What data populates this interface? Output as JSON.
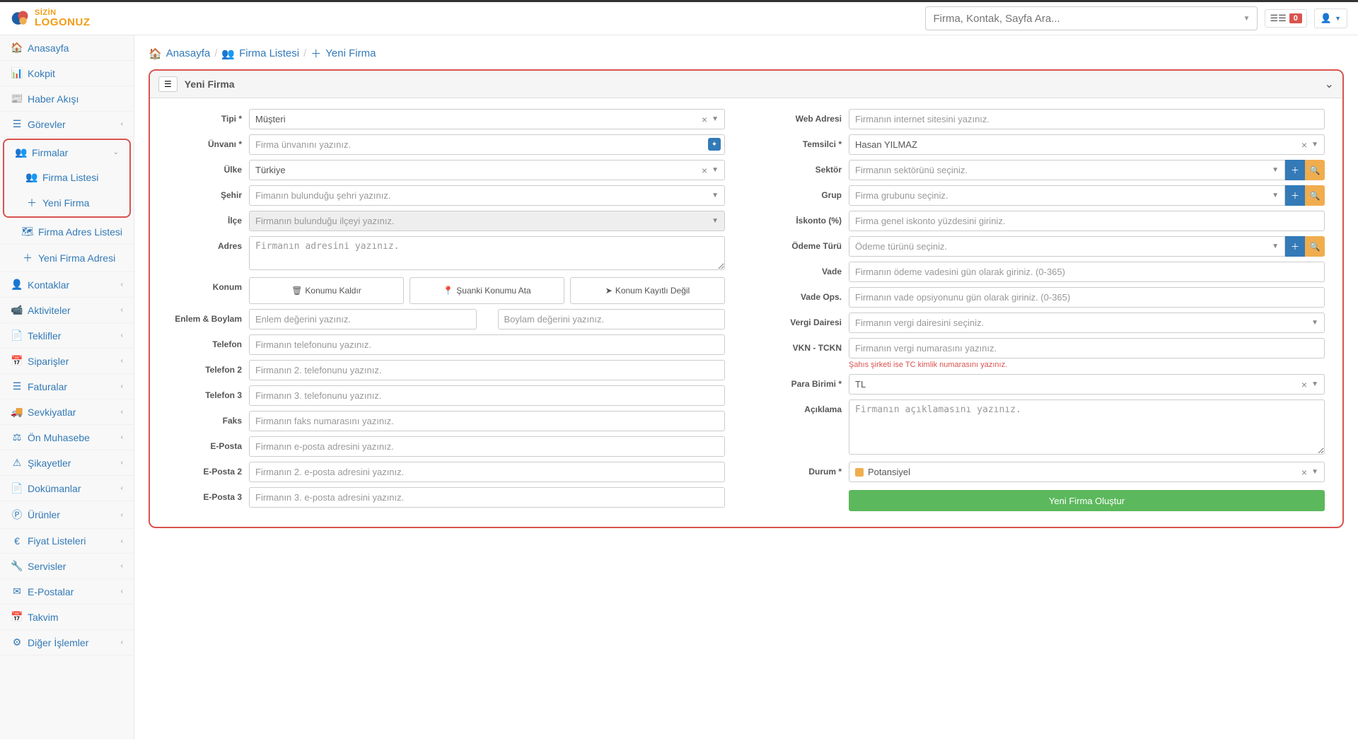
{
  "header": {
    "logo_line1": "SİZİN",
    "logo_line2": "LOGONUZ",
    "search_placeholder": "Firma, Kontak, Sayfa Ara...",
    "notification_count": "0"
  },
  "sidebar": {
    "items": [
      {
        "label": "Anasayfa",
        "icon": "home"
      },
      {
        "label": "Kokpit",
        "icon": "dashboard"
      },
      {
        "label": "Haber Akışı",
        "icon": "news"
      },
      {
        "label": "Görevler",
        "icon": "tasks",
        "chev": "‹"
      }
    ],
    "highlighted": {
      "parent": {
        "label": "Firmalar",
        "icon": "users",
        "chev": "⌄"
      },
      "children": [
        {
          "label": "Firma Listesi",
          "icon": "users"
        },
        {
          "label": "Yeni Firma",
          "icon": "plus"
        }
      ]
    },
    "items2": [
      {
        "label": "Firma Adres Listesi",
        "icon": "map"
      },
      {
        "label": "Yeni Firma Adresi",
        "icon": "plus"
      },
      {
        "label": "Kontaklar",
        "icon": "user",
        "chev": "‹"
      },
      {
        "label": "Aktiviteler",
        "icon": "video",
        "chev": "‹"
      },
      {
        "label": "Teklifler",
        "icon": "file",
        "chev": "‹"
      },
      {
        "label": "Siparişler",
        "icon": "calendar",
        "chev": "‹"
      },
      {
        "label": "Faturalar",
        "icon": "list",
        "chev": "‹"
      },
      {
        "label": "Sevkiyatlar",
        "icon": "truck",
        "chev": "‹"
      },
      {
        "label": "Ön Muhasebe",
        "icon": "balance",
        "chev": "‹"
      },
      {
        "label": "Şikayetler",
        "icon": "warning",
        "chev": "‹"
      },
      {
        "label": "Dokümanlar",
        "icon": "doc",
        "chev": "‹"
      },
      {
        "label": "Ürünler",
        "icon": "product",
        "chev": "‹"
      },
      {
        "label": "Fiyat Listeleri",
        "icon": "euro",
        "chev": "‹"
      },
      {
        "label": "Servisler",
        "icon": "wrench",
        "chev": "‹"
      },
      {
        "label": "E-Postalar",
        "icon": "mail",
        "chev": "‹"
      },
      {
        "label": "Takvim",
        "icon": "calendar2"
      },
      {
        "label": "Diğer İşlemler",
        "icon": "gear",
        "chev": "‹"
      }
    ]
  },
  "breadcrumb": {
    "home": "Anasayfa",
    "list": "Firma Listesi",
    "current": "Yeni Firma"
  },
  "panel": {
    "title": "Yeni Firma"
  },
  "form": {
    "left": {
      "tipi_label": "Tipi *",
      "tipi_value": "Müşteri",
      "unvan_label": "Ünvanı *",
      "unvan_placeholder": "Firma ünvanını yazınız.",
      "ulke_label": "Ülke",
      "ulke_value": "Türkiye",
      "sehir_label": "Şehir",
      "sehir_placeholder": "Fimanın bulunduğu şehri yazınız.",
      "ilce_label": "İlçe",
      "ilce_placeholder": "Firmanın bulunduğu ilçeyi yazınız.",
      "adres_label": "Adres",
      "adres_placeholder": "Firmanın adresini yazınız.",
      "konum_label": "Konum",
      "konum_kaldir": "Konumu Kaldır",
      "konum_ata": "Şuanki Konumu Ata",
      "konum_kayit": "Konum Kayıtlı Değil",
      "enlem_label": "Enlem & Boylam",
      "enlem_placeholder": "Enlem değerini yazınız.",
      "boylam_placeholder": "Boylam değerini yazınız.",
      "telefon_label": "Telefon",
      "telefon_placeholder": "Firmanın telefonunu yazınız.",
      "telefon2_label": "Telefon 2",
      "telefon2_placeholder": "Firmanın 2. telefonunu yazınız.",
      "telefon3_label": "Telefon 3",
      "telefon3_placeholder": "Firmanın 3. telefonunu yazınız.",
      "faks_label": "Faks",
      "faks_placeholder": "Firmanın faks numarasını yazınız.",
      "eposta_label": "E-Posta",
      "eposta_placeholder": "Firmanın e-posta adresini yazınız.",
      "eposta2_label": "E-Posta 2",
      "eposta2_placeholder": "Firmanın 2. e-posta adresini yazınız.",
      "eposta3_label": "E-Posta 3",
      "eposta3_placeholder": "Firmanın 3. e-posta adresini yazınız."
    },
    "right": {
      "web_label": "Web Adresi",
      "web_placeholder": "Firmanın internet sitesini yazınız.",
      "temsilci_label": "Temsilci *",
      "temsilci_value": "Hasan YILMAZ",
      "sektor_label": "Sektör",
      "sektor_placeholder": "Firmanın sektörünü seçiniz.",
      "grup_label": "Grup",
      "grup_placeholder": "Firma grubunu seçiniz.",
      "iskonto_label": "İskonto (%)",
      "iskonto_placeholder": "Firma genel iskonto yüzdesini giriniz.",
      "odeme_label": "Ödeme Türü",
      "odeme_placeholder": "Ödeme türünü seçiniz.",
      "vade_label": "Vade",
      "vade_placeholder": "Firmanın ödeme vadesini gün olarak giriniz. (0-365)",
      "vadeops_label": "Vade Ops.",
      "vadeops_placeholder": "Firmanın vade opsiyonunu gün olarak giriniz. (0-365)",
      "vergi_label": "Vergi Dairesi",
      "vergi_placeholder": "Firmanın vergi dairesini seçiniz.",
      "vkn_label": "VKN - TCKN",
      "vkn_placeholder": "Firmanın vergi numarasını yazınız.",
      "vkn_hint": "Şahıs şirketi ise TC kimlik numarasını yazınız.",
      "para_label": "Para Birimi *",
      "para_value": "TL",
      "aciklama_label": "Açıklama",
      "aciklama_placeholder": "Firmanın açıklamasını yazınız.",
      "durum_label": "Durum *",
      "durum_value": "Potansiyel",
      "submit": "Yeni Firma Oluştur"
    }
  }
}
